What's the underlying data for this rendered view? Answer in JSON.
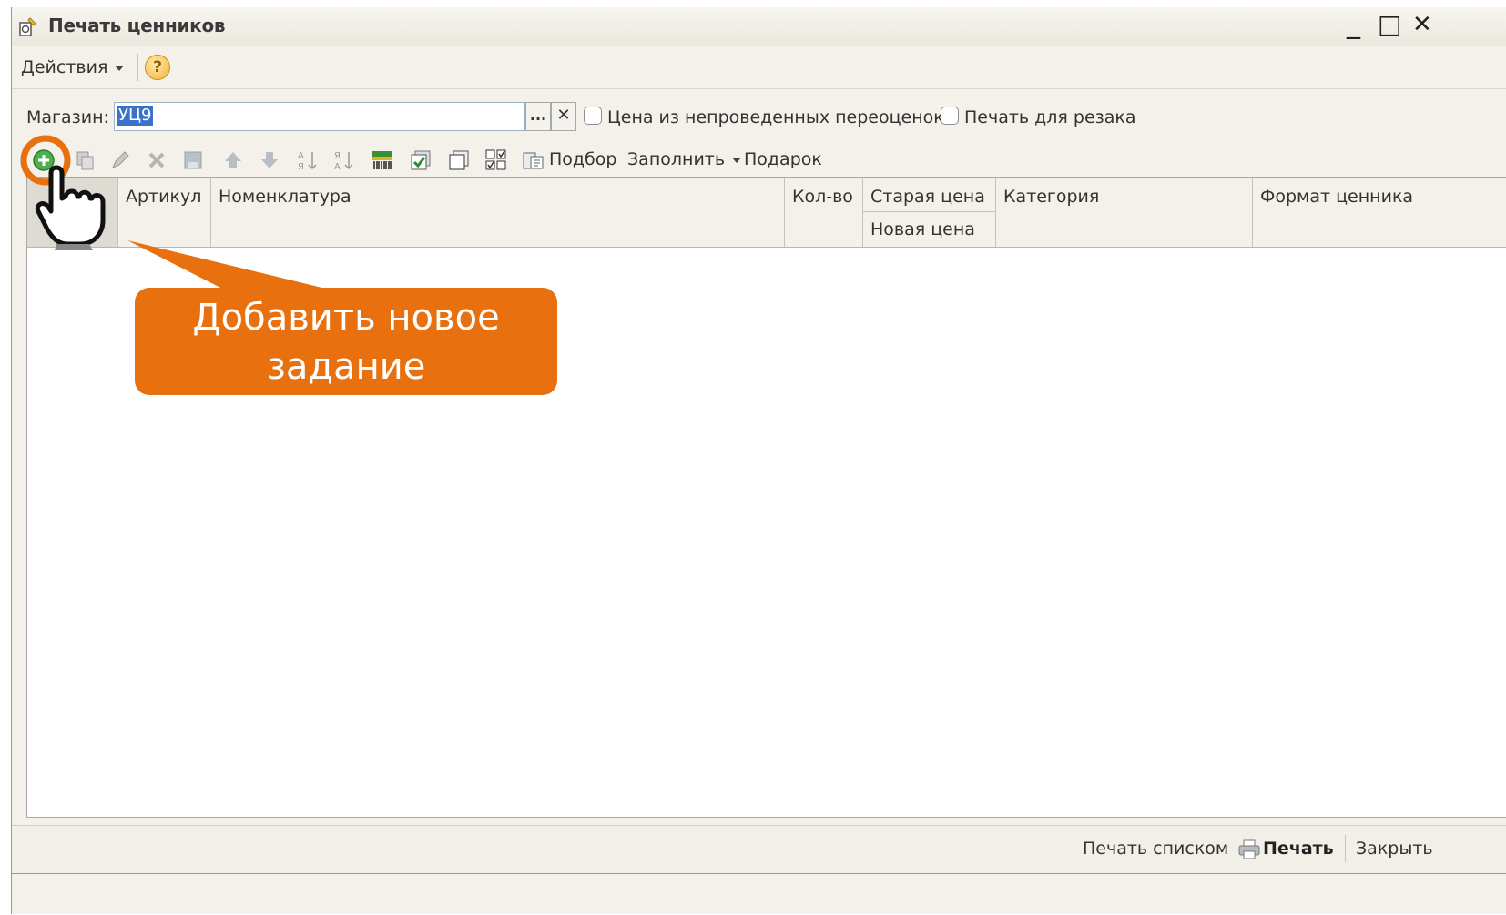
{
  "window": {
    "title": "Печать ценников",
    "minimize": "_",
    "maximize": "□",
    "close": "✕"
  },
  "menu": {
    "actions": "Действия",
    "help": "?"
  },
  "form": {
    "store_label": "Магазин:",
    "store_value": "УЦ9",
    "select_button": "...",
    "clear_button": "✕",
    "unposted_prices_label": "Цена из непроведенных переоценок",
    "cutter_print_label": "Печать для резака"
  },
  "toolbar": {
    "pick": "Подбор",
    "fill": "Заполнить",
    "gift": "Подарок",
    "icons": [
      "add-icon",
      "copy-icon",
      "edit-icon",
      "delete-icon",
      "save-icon",
      "move-up-icon",
      "move-down-icon",
      "sort-asc-icon",
      "sort-desc-icon",
      "barcode-icon",
      "check-icon",
      "copy-window-icon",
      "checklist-icon",
      "pick-icon"
    ]
  },
  "table": {
    "columns": {
      "article": "Артикул",
      "nomenclature": "Номенклатура",
      "quantity": "Кол-во",
      "old_price": "Старая цена",
      "new_price": "Новая цена",
      "category": "Категория",
      "label_format": "Формат ценника"
    }
  },
  "footer": {
    "print_list": "Печать списком",
    "print": "Печать",
    "close": "Закрыть"
  },
  "callout": {
    "line1": "Добавить новое",
    "line2": "задание"
  },
  "colors": {
    "callout": "#e8700e",
    "selection": "#3a72c9"
  }
}
